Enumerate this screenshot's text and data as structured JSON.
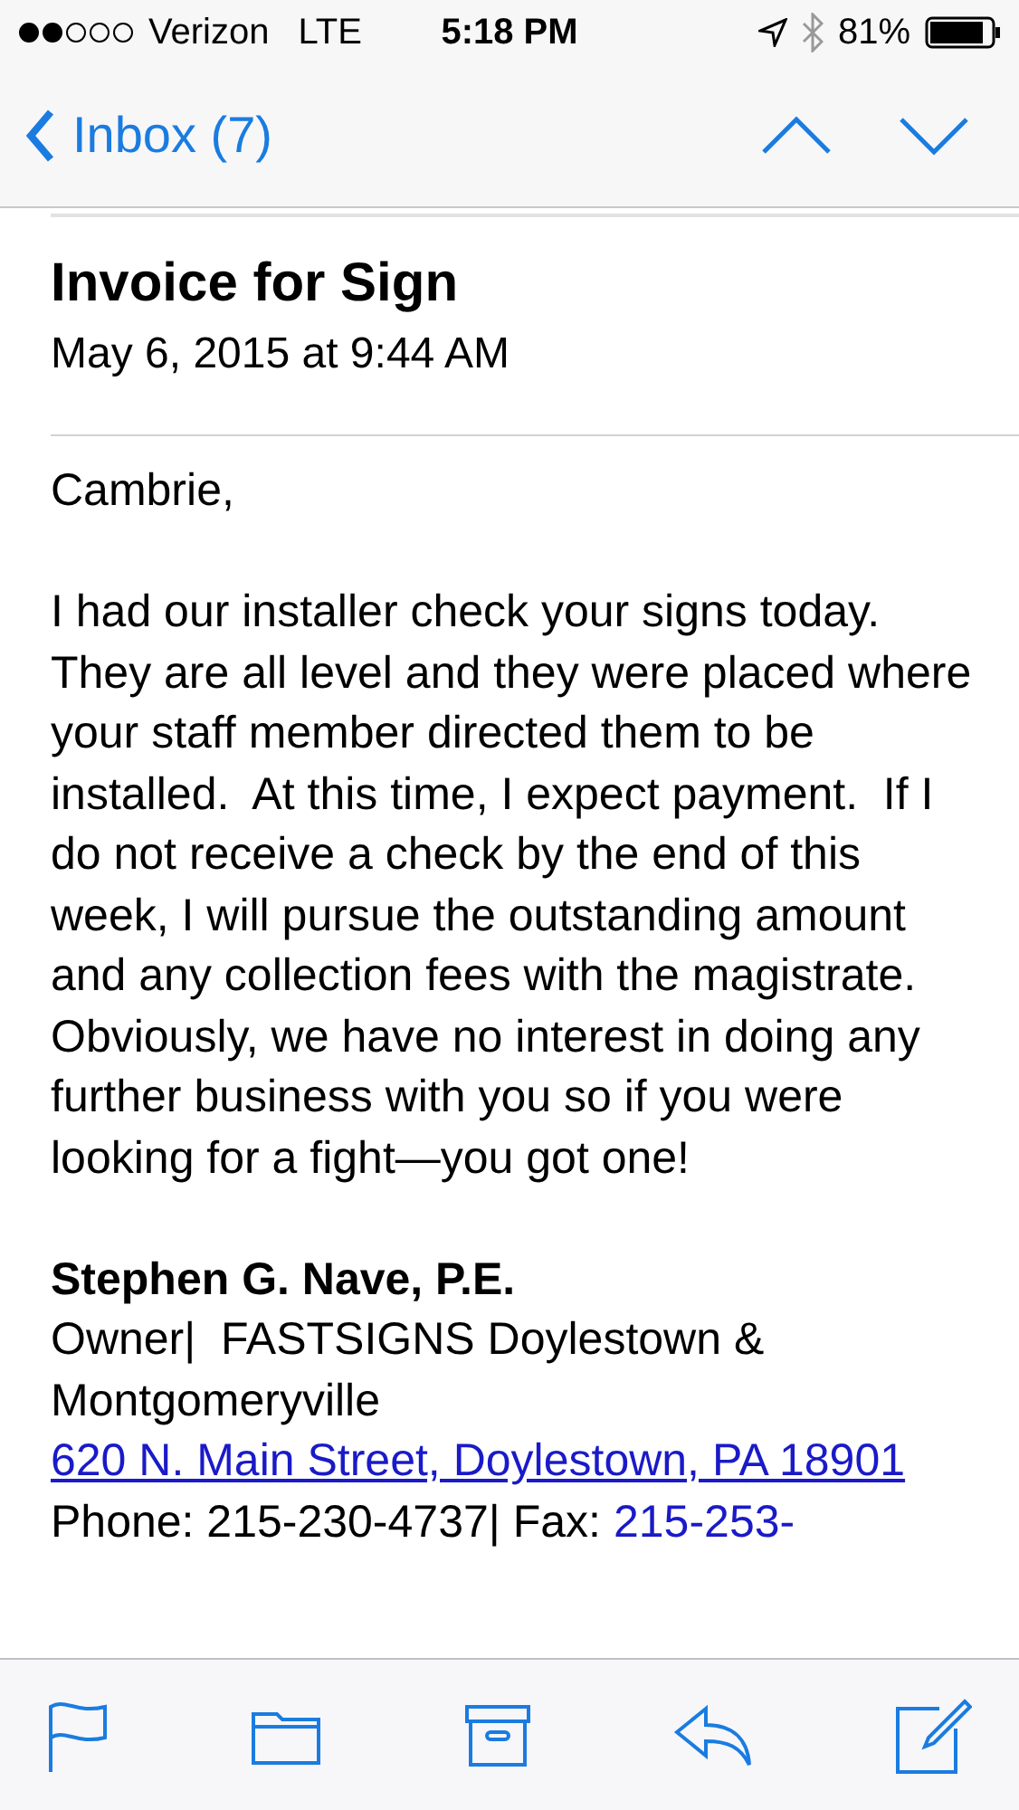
{
  "status_bar": {
    "carrier": "Verizon",
    "network": "LTE",
    "time": "5:18 PM",
    "battery": "81%"
  },
  "nav": {
    "back_label": "Inbox (7)"
  },
  "email": {
    "subject": "Invoice for Sign",
    "date": "May 6, 2015 at 9:44 AM",
    "greeting": "Cambrie,",
    "body": "I had our installer check your signs today.  They are all level and they were placed where your staff member directed them to be installed.  At this time, I expect payment.  If I do not receive a check by the end of this week, I will pursue the outstanding amount and any collection fees with the magistrate.  Obviously, we have no interest in doing any further business with you so if you were looking for a fight—you got one!",
    "signature": {
      "name": "Stephen G. Nave, P.E.",
      "title": "Owner|  FASTSIGNS Doylestown & Montgomeryville",
      "address": "620 N. Main Street, Doylestown, PA 18901",
      "phone": "Phone: 215-230-4737|",
      "fax_label": "Fax:",
      "fax": "215-253-"
    }
  },
  "toolbar": [
    {
      "kind": "flag"
    },
    {
      "kind": "folder"
    },
    {
      "kind": "archive"
    },
    {
      "kind": "reply"
    },
    {
      "kind": "compose"
    }
  ]
}
